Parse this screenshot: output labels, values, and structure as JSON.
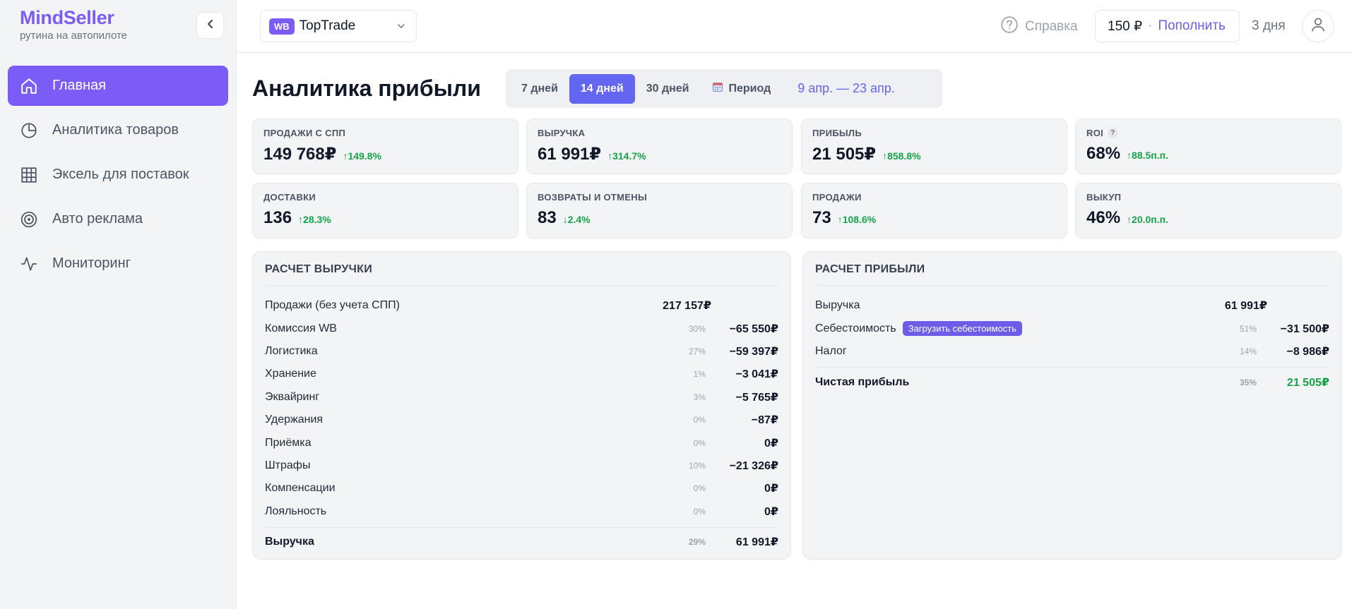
{
  "brand": {
    "title": "MindSeller",
    "subtitle": "рутина на автопилоте"
  },
  "sidebar": {
    "items": [
      {
        "label": "Главная",
        "icon": "home-icon",
        "active": true
      },
      {
        "label": "Аналитика товаров",
        "icon": "pie-chart-icon"
      },
      {
        "label": "Эксель для поставок",
        "icon": "table-grid-icon"
      },
      {
        "label": "Авто реклама",
        "icon": "target-icon"
      },
      {
        "label": "Мониторинг",
        "icon": "activity-icon"
      }
    ]
  },
  "topbar": {
    "shop_badge": "WB",
    "shop_name": "TopTrade",
    "help_label": "Справка",
    "balance": "150 ₽",
    "balance_sep": "·",
    "topup_label": "Пополнить",
    "days_left": "3 дня"
  },
  "page": {
    "title": "Аналитика прибыли",
    "periods": [
      "7 дней",
      "14 дней",
      "30 дней"
    ],
    "active_period": "14 дней",
    "custom_period_label": "Период",
    "date_range": "9 апр. — 23 апр."
  },
  "metrics": [
    {
      "label": "ПРОДАЖИ С СПП",
      "value": "149 768₽",
      "delta": "↑149.8%"
    },
    {
      "label": "ВЫРУЧКА",
      "value": "61 991₽",
      "delta": "↑314.7%"
    },
    {
      "label": "ПРИБЫЛЬ",
      "value": "21 505₽",
      "delta": "↑858.8%"
    },
    {
      "label": "ROI",
      "value": "68%",
      "delta": "↑88.5п.п.",
      "help": "?"
    },
    {
      "label": "ДОСТАВКИ",
      "value": "136",
      "delta": "↑28.3%"
    },
    {
      "label": "ВОЗВРАТЫ И ОТМЕНЫ",
      "value": "83",
      "delta": "↓2.4%"
    },
    {
      "label": "ПРОДАЖИ",
      "value": "73",
      "delta": "↑108.6%"
    },
    {
      "label": "ВЫКУП",
      "value": "46%",
      "delta": "↑20.0п.п."
    }
  ],
  "revenue_calc": {
    "title": "РАСЧЕТ ВЫРУЧКИ",
    "rows": [
      {
        "label": "Продажи (без учета СПП)",
        "pct": "",
        "value": "217 157₽"
      },
      {
        "label": "Комиссия WB",
        "pct": "30%",
        "value": "−65 550₽"
      },
      {
        "label": "Логистика",
        "pct": "27%",
        "value": "−59 397₽"
      },
      {
        "label": "Хранение",
        "pct": "1%",
        "value": "−3 041₽"
      },
      {
        "label": "Эквайринг",
        "pct": "3%",
        "value": "−5 765₽"
      },
      {
        "label": "Удержания",
        "pct": "0%",
        "value": "−87₽"
      },
      {
        "label": "Приёмка",
        "pct": "0%",
        "value": "0₽"
      },
      {
        "label": "Штрафы",
        "pct": "10%",
        "value": "−21 326₽"
      },
      {
        "label": "Компенсации",
        "pct": "0%",
        "value": "0₽"
      },
      {
        "label": "Лояльность",
        "pct": "0%",
        "value": "0₽"
      }
    ],
    "total": {
      "label": "Выручка",
      "pct": "29%",
      "value": "61 991₽"
    }
  },
  "profit_calc": {
    "title": "РАСЧЕТ ПРИБЫЛИ",
    "rows": [
      {
        "label": "Выручка",
        "pct": "",
        "value": "61 991₽"
      },
      {
        "label": "Себестоимость",
        "pct": "51%",
        "value": "−31 500₽",
        "action": "Загрузить себестоимость"
      },
      {
        "label": "Налог",
        "pct": "14%",
        "value": "−8 986₽"
      }
    ],
    "total": {
      "label": "Чистая прибыль",
      "pct": "35%",
      "value": "21 505₽"
    }
  },
  "colors": {
    "accent": "#7c5cf6",
    "indigo": "#6366f1",
    "positive": "#16a34a"
  }
}
